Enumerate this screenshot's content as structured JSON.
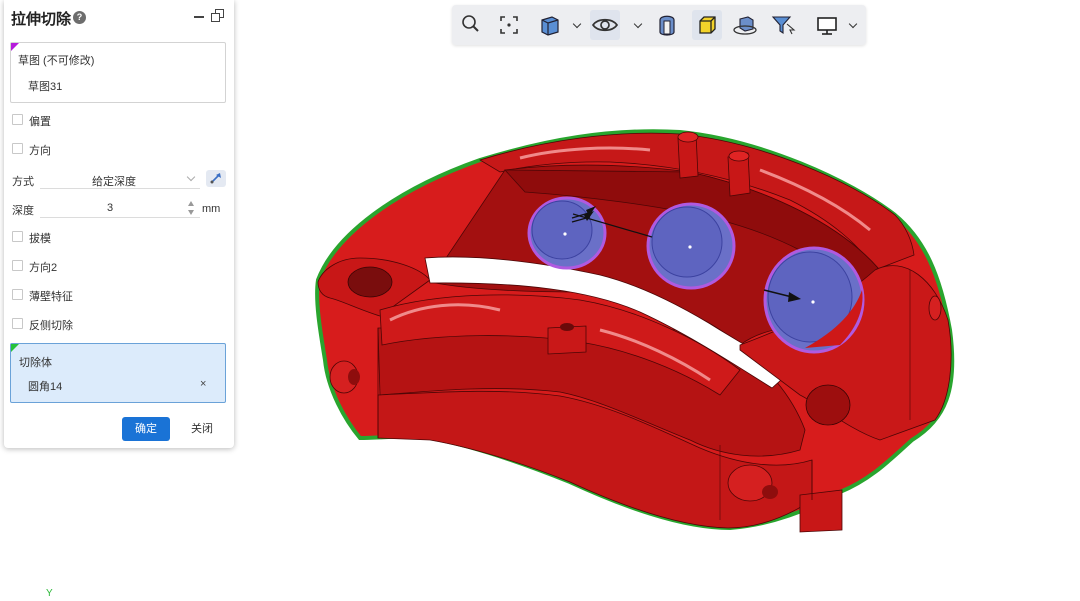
{
  "panel": {
    "title": "拉伸切除",
    "help_icon": "question-circle-icon",
    "sketch_label": "草图 (不可修改)",
    "sketch_value": "草图31",
    "options": {
      "offset": "偏置",
      "direction": "方向",
      "draft": "拔模",
      "direction2": "方向2",
      "thin_feature": "薄壁特征",
      "reverse_cut": "反侧切除"
    },
    "method_label": "方式",
    "method_value": "给定深度",
    "depth_label": "深度",
    "depth_value": "3",
    "depth_unit": "mm",
    "cut_body_label": "切除体",
    "cut_body_value": "圆角14",
    "remove_icon": "×",
    "ok_label": "确定",
    "close_label": "关闭"
  },
  "toolbar": {
    "icons": [
      "zoom-icon",
      "zoom-fit-icon",
      "view-cube-icon",
      "visibility-icon",
      "section-view-icon",
      "shaded-view-icon",
      "rotate-view-icon",
      "selection-filter-icon",
      "display-icon"
    ]
  },
  "viewport": {
    "axis_label": "Y",
    "model_color": "#d91d1d",
    "outline_color": "#27a327",
    "selected_face_color": "#6a70cc"
  }
}
